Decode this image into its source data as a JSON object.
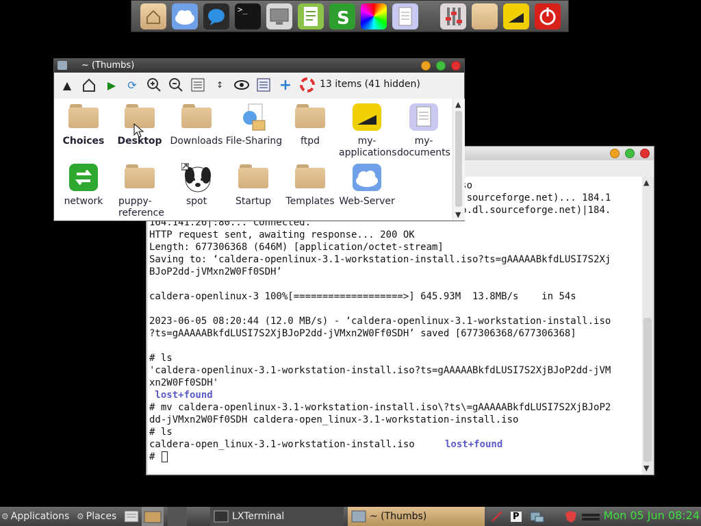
{
  "dock": {
    "icons": [
      "home-icon",
      "cloud-icon",
      "chat-icon",
      "terminal-icon",
      "monitor-icon",
      "document-icon",
      "spreadsheet-icon",
      "color-wheel-icon",
      "text-file-icon",
      "settings-icon",
      "folder-icon",
      "flag-icon",
      "power-icon"
    ],
    "terminal_glyph": ">_"
  },
  "file_manager": {
    "title": "~ (Thumbs)",
    "item_count": "13 items (41 hidden)",
    "items": [
      {
        "label": "Choices",
        "icon": "folder-icon",
        "bold": true
      },
      {
        "label": "Desktop",
        "icon": "folder-icon",
        "bold": true
      },
      {
        "label": "Downloads",
        "icon": "folder-icon",
        "bold": false
      },
      {
        "label": "File-Sharing",
        "icon": "network-share-icon",
        "bold": false
      },
      {
        "label": "ftpd",
        "icon": "folder-icon",
        "bold": false
      },
      {
        "label": "my-applications",
        "label_line1": "my-",
        "label_line2": "applications",
        "icon": "apps-icon",
        "bold": false
      },
      {
        "label": "my-documents",
        "label_line1": "my-",
        "label_line2": "documents",
        "icon": "documents-icon",
        "bold": false
      },
      {
        "label": "network",
        "icon": "network-icon",
        "bold": false
      },
      {
        "label": "puppy-reference",
        "label_line1": "puppy-",
        "label_line2": "reference",
        "icon": "folder-icon",
        "bold": false
      },
      {
        "label": "spot",
        "icon": "puppy-icon",
        "bold": false
      },
      {
        "label": "Startup",
        "icon": "folder-icon",
        "bold": false
      },
      {
        "label": "Templates",
        "icon": "folder-icon",
        "bold": false
      },
      {
        "label": "Web-Server",
        "icon": "cloud-icon",
        "bold": false
      }
    ]
  },
  "terminal": {
    "lines": [
      {
        "text": "                                                    .iso",
        "bold": false
      },
      {
        "text": "                                                   .dl.sourceforge.net)... 184.1",
        "bold": false
      },
      {
        "text": "Connecting to phoenixnap.dl.sourceforge.net (phoenixnap.dl.sourceforge.net)|184.",
        "bold": false
      },
      {
        "text": "164.141.26|:80... connected.",
        "bold": false
      },
      {
        "text": "HTTP request sent, awaiting response... 200 OK",
        "bold": false
      },
      {
        "text": "Length: 677306368 (646M) [application/octet-stream]",
        "bold": false
      },
      {
        "text": "Saving to: ‘caldera-openlinux-3.1-workstation-install.iso?ts=gAAAAABkfdLUSI7S2Xj",
        "bold": false
      },
      {
        "text": "BJoP2dd-jVMxn2W0Ff0SDH’",
        "bold": false
      },
      {
        "text": "",
        "bold": false
      },
      {
        "text": "caldera-openlinux-3 100%[===================>] 645.93M  13.8MB/s    in 54s",
        "bold": false
      },
      {
        "text": "",
        "bold": false
      },
      {
        "text": "2023-06-05 08:20:44 (12.0 MB/s) - ‘caldera-openlinux-3.1-workstation-install.iso",
        "bold": false
      },
      {
        "text": "?ts=gAAAAABkfdLUSI7S2XjBJoP2dd-jVMxn2W0Ff0SDH’ saved [677306368/677306368]",
        "bold": false
      },
      {
        "text": "",
        "bold": false
      },
      {
        "text": "# ls",
        "bold": false
      },
      {
        "text": "'caldera-openlinux-3.1-workstation-install.iso?ts=gAAAAABkfdLUSI7S2XjBJoP2dd-jVM",
        "bold": false
      },
      {
        "text": "xn2W0Ff0SDH'",
        "bold": false
      },
      {
        "text": " lost+found",
        "bold": true
      },
      {
        "text": "# mv caldera-openlinux-3.1-workstation-install.iso\\?ts\\=gAAAAABkfdLUSI7S2XjBJoP2",
        "bold": false
      },
      {
        "text": "dd-jVMxn2W0Ff0SDH caldera-open_linux-3.1-workstation-install.iso",
        "bold": false
      },
      {
        "text": "# ls",
        "bold": false
      },
      {
        "text": "caldera-open_linux-3.1-workstation-install.iso",
        "bold": false
      },
      {
        "text": "# ",
        "bold": false
      }
    ],
    "lost_found_inline": "lost+found"
  },
  "taskbar": {
    "applications": "Applications",
    "places": "Places",
    "lxterminal": "LXTerminal",
    "thumbs": "~ (Thumbs)",
    "clock": "Mon 05 Jun 08:24"
  },
  "colors": {
    "terminal_bold": "#5a5ac8",
    "clock": "#40e040",
    "taskbar_active": "#c8a060"
  }
}
